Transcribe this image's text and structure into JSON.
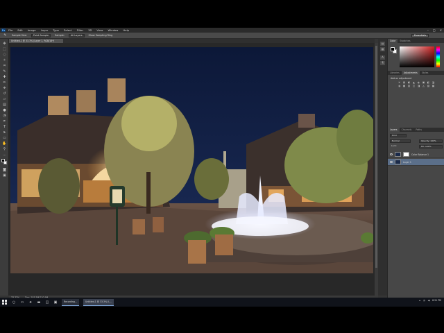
{
  "menubar": {
    "logo": "Ps",
    "items": [
      "File",
      "Edit",
      "Image",
      "Layer",
      "Type",
      "Select",
      "Filter",
      "3D",
      "View",
      "Window",
      "Help"
    ],
    "window_controls": [
      "–",
      "□",
      "×"
    ]
  },
  "options_bar": {
    "sample_size_label": "Sample Size:",
    "sample_size_value": "Point Sample",
    "sample_label": "Sample:",
    "sample_value": "All Layers",
    "show_ring_label": "Show Sampling Ring",
    "workspace_value": "Essentials"
  },
  "document": {
    "tab_title": "Untitled-1 @ 33.3% (Layer 1, RGB/16*)"
  },
  "status": {
    "zoom": "33.33%",
    "doc_size": "Doc: 105.5M/210.9M"
  },
  "panels": {
    "color_tabs": [
      "Color",
      "Swatches"
    ],
    "fg_color": "#000000",
    "bg_color": "#ffffff",
    "adjust_tabs": [
      "Libraries",
      "Adjustments",
      "Styles"
    ],
    "adjust_title": "Add an adjustment",
    "adjust_icons": [
      "☀",
      "▤",
      "◩",
      "▲",
      "◐",
      "▣",
      "◧",
      "◪",
      "◑",
      "▦",
      "▥",
      "◫",
      "◨",
      "◬",
      "▧",
      "▩"
    ],
    "layers_tabs": [
      "Layers",
      "Channels",
      "Paths"
    ],
    "kind_label": "Kind",
    "blend_mode": "Normal",
    "opacity_label": "Opacity: 100%",
    "lock_label": "Lock:",
    "fill_label": "Fill: 100%",
    "layers": [
      {
        "name": "Color Balance 1",
        "selected": false
      },
      {
        "name": "Layer 1",
        "selected": true
      }
    ]
  },
  "taskbar": {
    "apps": [
      {
        "label": "Recording...",
        "active": false
      },
      {
        "label": "Untitled-1 @ 33.3% (L...",
        "active": true
      }
    ],
    "time": "8:51 PM"
  },
  "colors": {
    "sky_top": "#0d1a3a",
    "accent": "#5b6f8a"
  }
}
